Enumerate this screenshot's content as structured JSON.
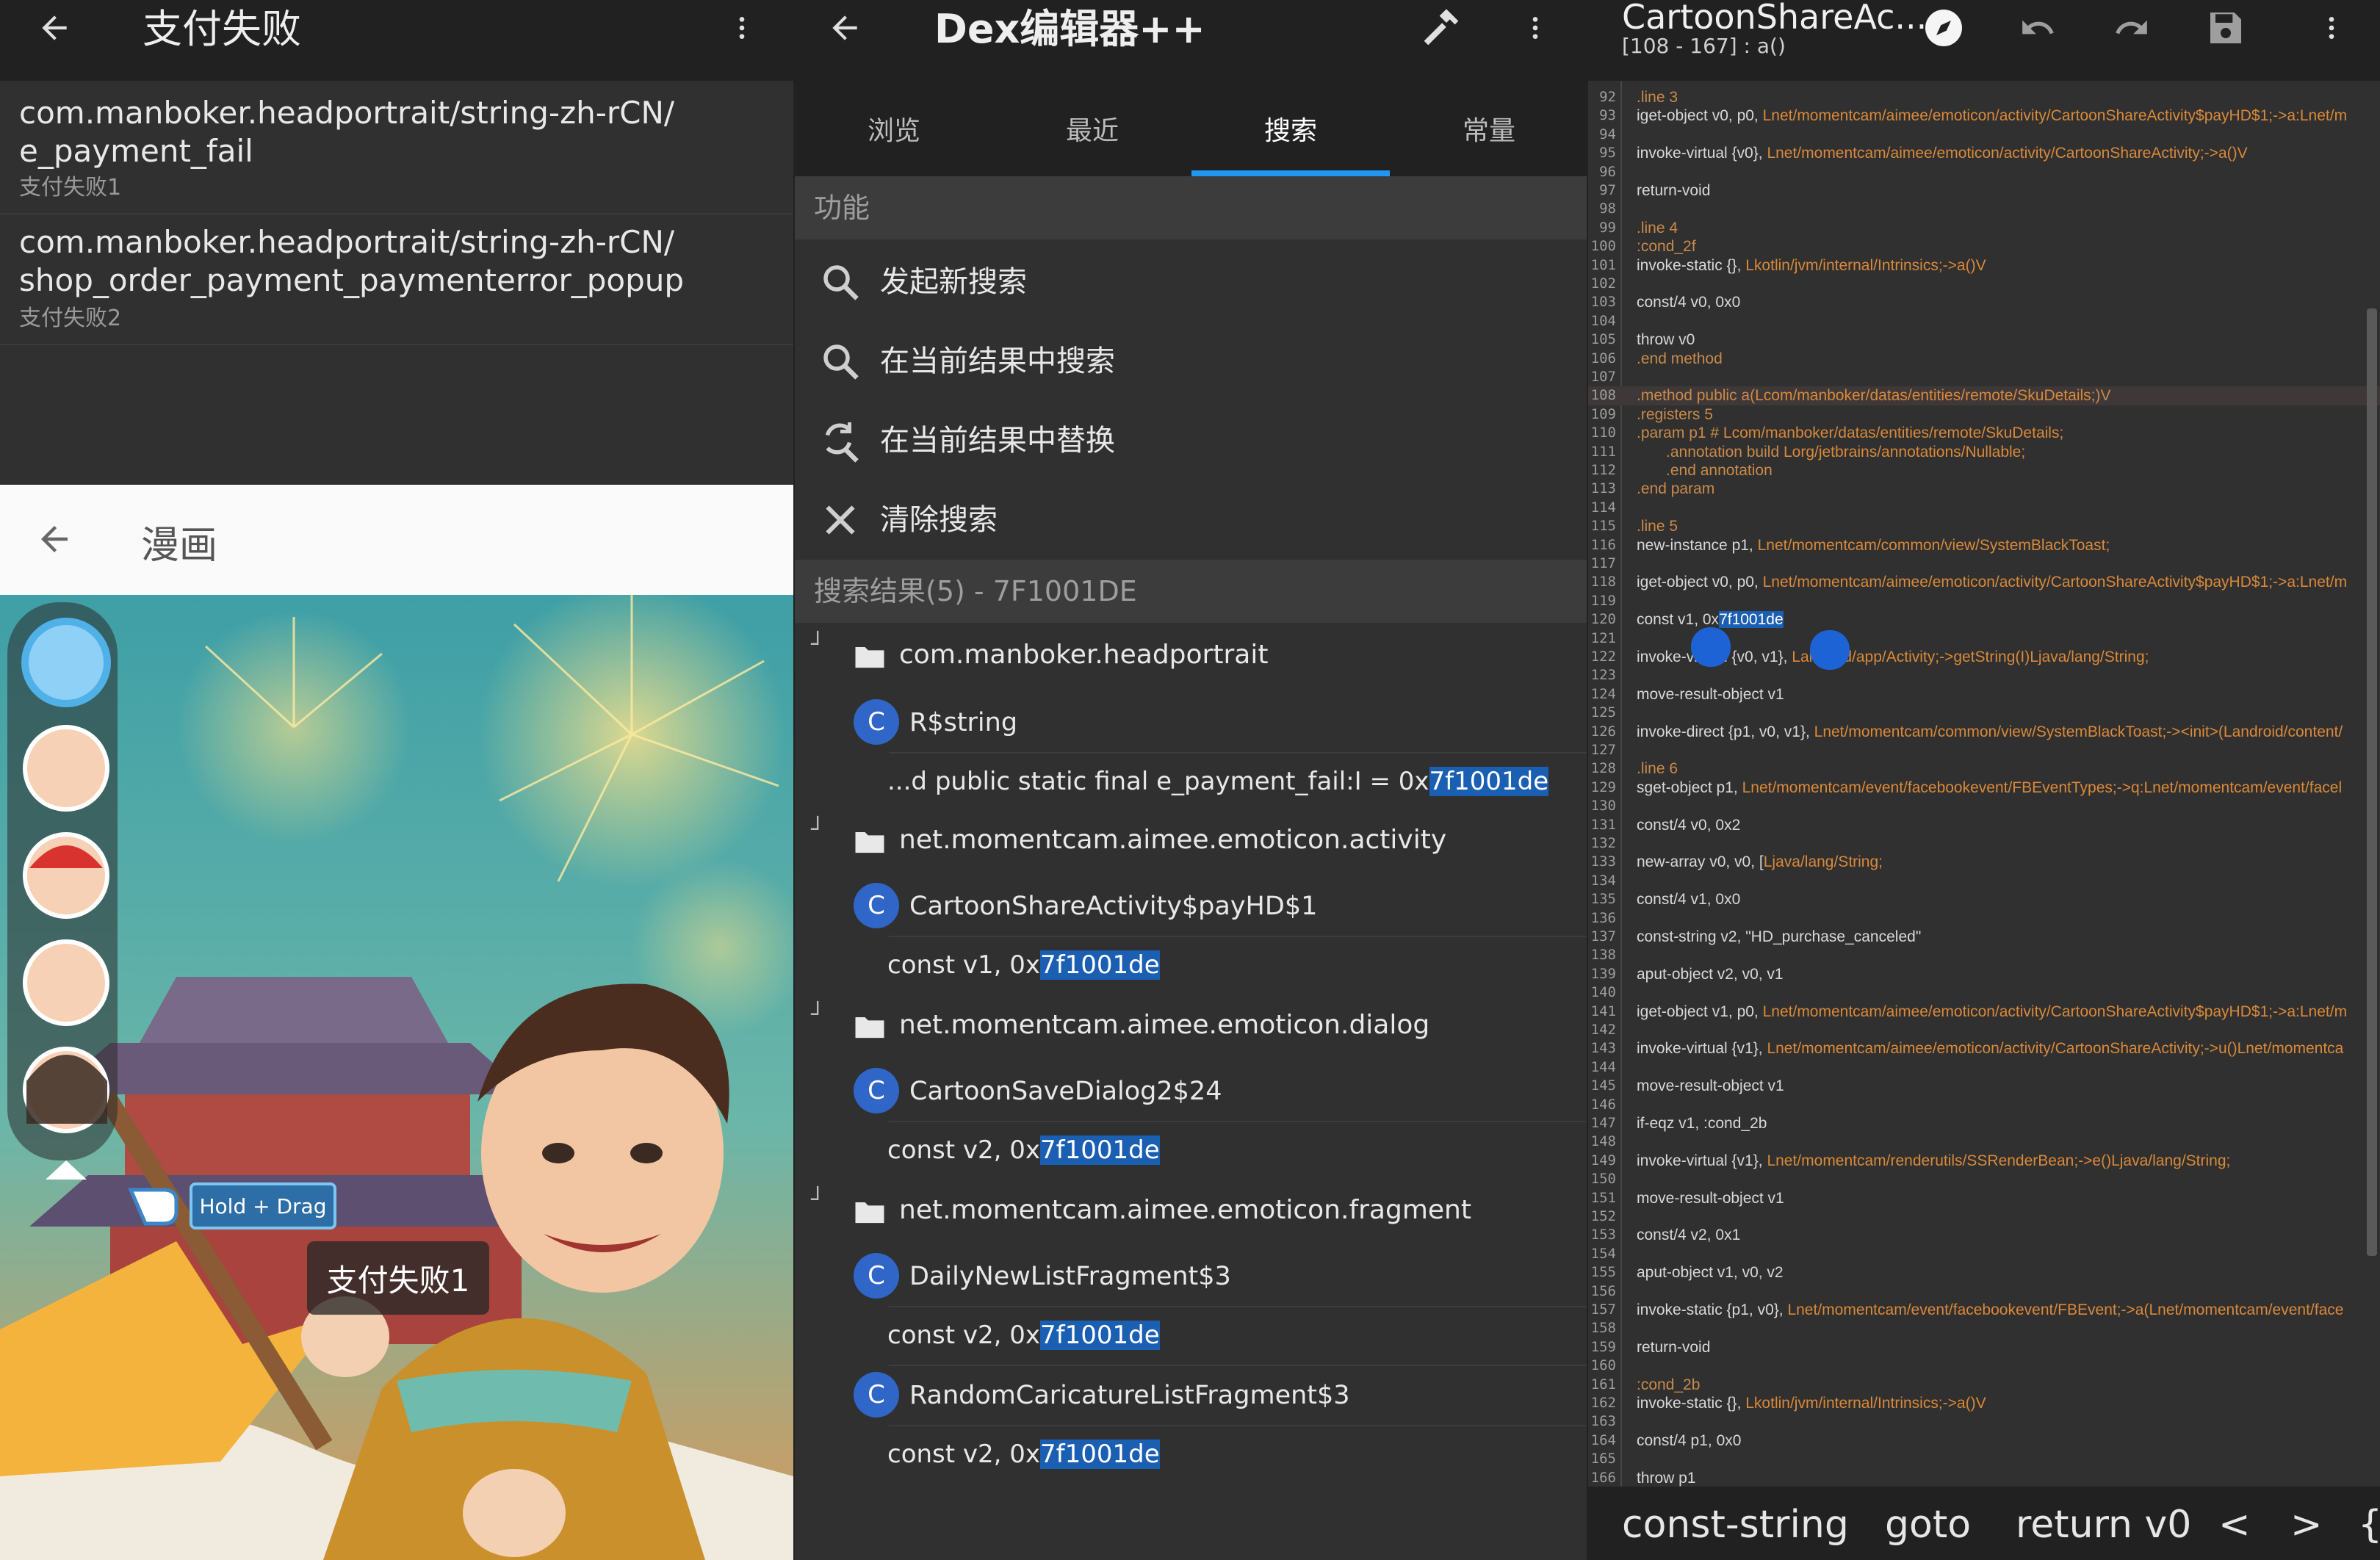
{
  "screen1": {
    "title": "支付失败",
    "items": [
      {
        "path": "com.manboker.headportrait/string-zh-rCN/\ne_payment_fail",
        "value": "支付失败1"
      },
      {
        "path": "com.manboker.headportrait/string-zh-rCN/\nshop_order_payment_paymenterror_popup",
        "value": "支付失败2"
      }
    ],
    "dialog": {
      "title": "漫画",
      "hold_drag": "Hold + Drag",
      "toast": "支付失败1"
    }
  },
  "screen2": {
    "title": "Dex编辑器++",
    "tabs": [
      "浏览",
      "最近",
      "搜索",
      "常量"
    ],
    "active_tab": 2,
    "functions_header": "功能",
    "functions": [
      "发起新搜索",
      "在当前结果中搜索",
      "在当前结果中替换",
      "清除搜索"
    ],
    "results_header": "搜索结果(5) - 7F1001DE",
    "results": {
      "g1_pkg": "com.manboker.headportrait",
      "g1_cls": "R$string",
      "g1_line_pre": "...d public static final e_payment_fail:I = 0x",
      "g1_line_hl": "7f1001de",
      "g2_pkg": "net.momentcam.aimee.emoticon.activity",
      "g2_cls": "CartoonShareActivity$payHD$1",
      "g2_line_pre": "const v1, 0x",
      "g2_line_hl": "7f1001de",
      "g3_pkg": "net.momentcam.aimee.emoticon.dialog",
      "g3_cls": "CartoonSaveDialog2$24",
      "g3_line_pre": "const v2, 0x",
      "g3_line_hl": "7f1001de",
      "g4_pkg": "net.momentcam.aimee.emoticon.fragment",
      "g4_cls1": "DailyNewListFragment$3",
      "g4_line1_pre": "const v2, 0x",
      "g4_line1_hl": "7f1001de",
      "g4_cls2": "RandomCaricatureListFragment$3",
      "g4_line2_pre": "const v2, 0x",
      "g4_line2_hl": "7f1001de"
    }
  },
  "screen3": {
    "title": "CartoonShareAc...",
    "subtitle": "[108 - 167] : a()",
    "code": [
      {
        "n": "92",
        "t": ".line 3"
      },
      {
        "n": "93",
        "t": "iget-object v0, p0, Lnet/momentcam/aimee/emoticon/activity/CartoonShareActivity$payHD$1;->a:Lnet/m"
      },
      {
        "n": "94",
        "t": ""
      },
      {
        "n": "95",
        "t": "invoke-virtual {v0}, Lnet/momentcam/aimee/emoticon/activity/CartoonShareActivity;->a()V"
      },
      {
        "n": "96",
        "t": ""
      },
      {
        "n": "97",
        "t": "return-void"
      },
      {
        "n": "98",
        "t": ""
      },
      {
        "n": "99",
        "t": ".line 4"
      },
      {
        "n": "100",
        "t": ":cond_2f"
      },
      {
        "n": "101",
        "t": "invoke-static {}, Lkotlin/jvm/internal/Intrinsics;->a()V"
      },
      {
        "n": "102",
        "t": ""
      },
      {
        "n": "103",
        "t": "const/4 v0, 0x0"
      },
      {
        "n": "104",
        "t": ""
      },
      {
        "n": "105",
        "t": "throw v0"
      },
      {
        "n": "106",
        "t": ".end method"
      },
      {
        "n": "107",
        "t": ""
      },
      {
        "n": "108",
        "t": ".method public a(Lcom/manboker/datas/entities/remote/SkuDetails;)V"
      },
      {
        "n": "109",
        "t": ".registers 5"
      },
      {
        "n": "110",
        "t": ".param p1    # Lcom/manboker/datas/entities/remote/SkuDetails;"
      },
      {
        "n": "111",
        "t": "    .annotation build Lorg/jetbrains/annotations/Nullable;"
      },
      {
        "n": "112",
        "t": "    .end annotation"
      },
      {
        "n": "113",
        "t": ".end param"
      },
      {
        "n": "114",
        "t": ""
      },
      {
        "n": "115",
        "t": ".line 5"
      },
      {
        "n": "116",
        "t": "new-instance p1, Lnet/momentcam/common/view/SystemBlackToast;"
      },
      {
        "n": "117",
        "t": ""
      },
      {
        "n": "118",
        "t": "iget-object v0, p0, Lnet/momentcam/aimee/emoticon/activity/CartoonShareActivity$payHD$1;->a:Lnet/m"
      },
      {
        "n": "119",
        "t": ""
      },
      {
        "n": "120",
        "t": "const v1, 0x7f1001de"
      },
      {
        "n": "121",
        "t": ""
      },
      {
        "n": "122",
        "t": "invoke-virtual {v0, v1}, Landroid/app/Activity;->getString(I)Ljava/lang/String;"
      },
      {
        "n": "123",
        "t": ""
      },
      {
        "n": "124",
        "t": "move-result-object v1"
      },
      {
        "n": "125",
        "t": ""
      },
      {
        "n": "126",
        "t": "invoke-direct {p1, v0, v1}, Lnet/momentcam/common/view/SystemBlackToast;-><init>(Landroid/content/"
      },
      {
        "n": "127",
        "t": ""
      },
      {
        "n": "128",
        "t": ".line 6"
      },
      {
        "n": "129",
        "t": "sget-object p1, Lnet/momentcam/event/facebookevent/FBEventTypes;->q:Lnet/momentcam/event/facel"
      },
      {
        "n": "130",
        "t": ""
      },
      {
        "n": "131",
        "t": "const/4 v0, 0x2"
      },
      {
        "n": "132",
        "t": ""
      },
      {
        "n": "133",
        "t": "new-array v0, v0, [Ljava/lang/String;"
      },
      {
        "n": "134",
        "t": ""
      },
      {
        "n": "135",
        "t": "const/4 v1, 0x0"
      },
      {
        "n": "136",
        "t": ""
      },
      {
        "n": "137",
        "t": "const-string v2, \"HD_purchase_canceled\""
      },
      {
        "n": "138",
        "t": ""
      },
      {
        "n": "139",
        "t": "aput-object v2, v0, v1"
      },
      {
        "n": "140",
        "t": ""
      },
      {
        "n": "141",
        "t": "iget-object v1, p0, Lnet/momentcam/aimee/emoticon/activity/CartoonShareActivity$payHD$1;->a:Lnet/m"
      },
      {
        "n": "142",
        "t": ""
      },
      {
        "n": "143",
        "t": "invoke-virtual {v1}, Lnet/momentcam/aimee/emoticon/activity/CartoonShareActivity;->u()Lnet/momentca"
      },
      {
        "n": "144",
        "t": ""
      },
      {
        "n": "145",
        "t": "move-result-object v1"
      },
      {
        "n": "146",
        "t": ""
      },
      {
        "n": "147",
        "t": "if-eqz v1, :cond_2b"
      },
      {
        "n": "148",
        "t": ""
      },
      {
        "n": "149",
        "t": "invoke-virtual {v1}, Lnet/momentcam/renderutils/SSRenderBean;->e()Ljava/lang/String;"
      },
      {
        "n": "150",
        "t": ""
      },
      {
        "n": "151",
        "t": "move-result-object v1"
      },
      {
        "n": "152",
        "t": ""
      },
      {
        "n": "153",
        "t": "const/4 v2, 0x1"
      },
      {
        "n": "154",
        "t": ""
      },
      {
        "n": "155",
        "t": "aput-object v1, v0, v2"
      },
      {
        "n": "156",
        "t": ""
      },
      {
        "n": "157",
        "t": "invoke-static {p1, v0}, Lnet/momentcam/event/facebookevent/FBEvent;->a(Lnet/momentcam/event/face"
      },
      {
        "n": "158",
        "t": ""
      },
      {
        "n": "159",
        "t": "return-void"
      },
      {
        "n": "160",
        "t": ""
      },
      {
        "n": "161",
        "t": ":cond_2b"
      },
      {
        "n": "162",
        "t": "invoke-static {}, Lkotlin/jvm/internal/Intrinsics;->a()V"
      },
      {
        "n": "163",
        "t": ""
      },
      {
        "n": "164",
        "t": "const/4 p1, 0x0"
      },
      {
        "n": "165",
        "t": ""
      },
      {
        "n": "166",
        "t": "throw p1"
      }
    ],
    "bottom_bar": [
      "const-string",
      "goto",
      "return v0",
      "<",
      ">",
      "{"
    ]
  },
  "colors": {
    "accent": "#2196f3",
    "highlight": "#1b5fb3",
    "class_badge": "#2f66c8",
    "app_bar": "#212121",
    "background": "#303030"
  },
  "icons": {
    "screen1_left": [
      "back-arrow-icon"
    ],
    "screen1_right": [
      "overflow-menu-icon"
    ],
    "screen2_left": [
      "back-arrow-icon"
    ],
    "screen2_right": [
      "hammer-icon",
      "overflow-menu-icon"
    ],
    "screen3_right": [
      "compass-icon",
      "undo-icon",
      "redo-icon",
      "save-icon",
      "overflow-menu-icon"
    ],
    "functions": [
      "search-icon",
      "search-icon",
      "find-replace-icon",
      "close-icon"
    ],
    "results": [
      "folder-icon",
      "class-c-icon"
    ]
  }
}
